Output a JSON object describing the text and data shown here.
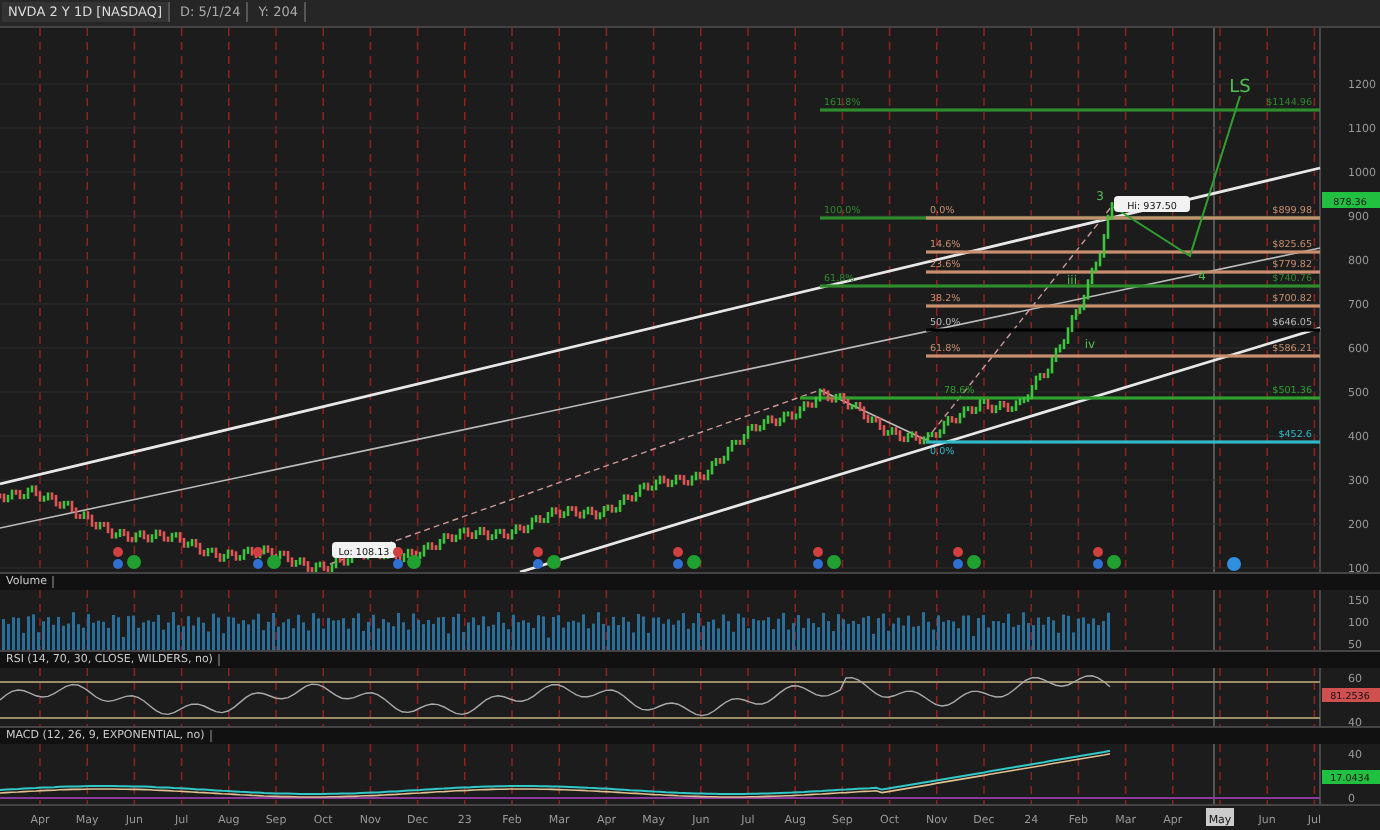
{
  "header": {
    "symbol": "NVDA 2 Y 1D [NASDAQ]",
    "date": "D: 5/1/24",
    "extra": "Y: 204"
  },
  "price_axis": [
    "1200",
    "1100",
    "1000",
    "900",
    "800",
    "700",
    "600",
    "500",
    "400",
    "300",
    "200",
    "100"
  ],
  "current_price": "878.36",
  "fib_levels": [
    {
      "label": "161.8%",
      "price": "$1144.96",
      "color": "#2e8b2e"
    },
    {
      "label": "100.0%",
      "color": "#2e8b2e"
    },
    {
      "label": "0.0%",
      "price": "$899.98",
      "color": "#c89070"
    },
    {
      "label": "14.6%",
      "price": "$825.65",
      "color": "#c89070"
    },
    {
      "label": "23.6%",
      "price": "$779.82",
      "color": "#c89070"
    },
    {
      "label": "61.8%",
      "price": "$740.76",
      "color": "#2e8b2e"
    },
    {
      "label": "38.2%",
      "price": "$700.82",
      "color": "#c89070"
    },
    {
      "label": "50.0%",
      "price": "$646.05",
      "color": "#000000"
    },
    {
      "label": "61.8%",
      "price": "$586.21",
      "color": "#c89070"
    },
    {
      "label": "78.6%",
      "price": "$501.36",
      "color": "#2ea02e"
    },
    {
      "label": "0.0%",
      "price": "$452.6",
      "color": "#30b8c8"
    }
  ],
  "wave_labels": [
    "3",
    "4",
    "LS",
    "iii",
    "iv"
  ],
  "annotations": {
    "high": "Hi: 937.50",
    "low": "Lo: 108.13"
  },
  "panels": [
    {
      "kind": "volume",
      "title": "Volume",
      "axis": [
        "150",
        "100",
        "50"
      ]
    },
    {
      "kind": "rsi",
      "title": "RSI (14, 70, 30, CLOSE, WILDERS, no)",
      "axis": [
        "60",
        "40"
      ],
      "reading": "81.2536"
    },
    {
      "kind": "macd",
      "title": "MACD (12, 26, 9, EXPONENTIAL, no)",
      "axis": [
        "40",
        "0"
      ],
      "reading": "17.0434"
    }
  ],
  "months": [
    {
      "label": "Apr",
      "selected": false
    },
    {
      "label": "May",
      "selected": false
    },
    {
      "label": "Jun",
      "selected": false
    },
    {
      "label": "Jul",
      "selected": false
    },
    {
      "label": "Aug",
      "selected": false
    },
    {
      "label": "Sep",
      "selected": false
    },
    {
      "label": "Oct",
      "selected": false
    },
    {
      "label": "Nov",
      "selected": false
    },
    {
      "label": "Dec",
      "selected": false
    },
    {
      "label": "23",
      "selected": false
    },
    {
      "label": "Feb",
      "selected": false
    },
    {
      "label": "Mar",
      "selected": false
    },
    {
      "label": "Apr",
      "selected": false
    },
    {
      "label": "May",
      "selected": false
    },
    {
      "label": "Jun",
      "selected": false
    },
    {
      "label": "Jul",
      "selected": false
    },
    {
      "label": "Aug",
      "selected": false
    },
    {
      "label": "Sep",
      "selected": false
    },
    {
      "label": "Oct",
      "selected": false
    },
    {
      "label": "Nov",
      "selected": false
    },
    {
      "label": "Dec",
      "selected": false
    },
    {
      "label": "24",
      "selected": false
    },
    {
      "label": "Feb",
      "selected": false
    },
    {
      "label": "Mar",
      "selected": false
    },
    {
      "label": "Apr",
      "selected": false
    },
    {
      "label": "May",
      "selected": true
    },
    {
      "label": "Jun",
      "selected": false
    },
    {
      "label": "Jul",
      "selected": false
    }
  ]
}
